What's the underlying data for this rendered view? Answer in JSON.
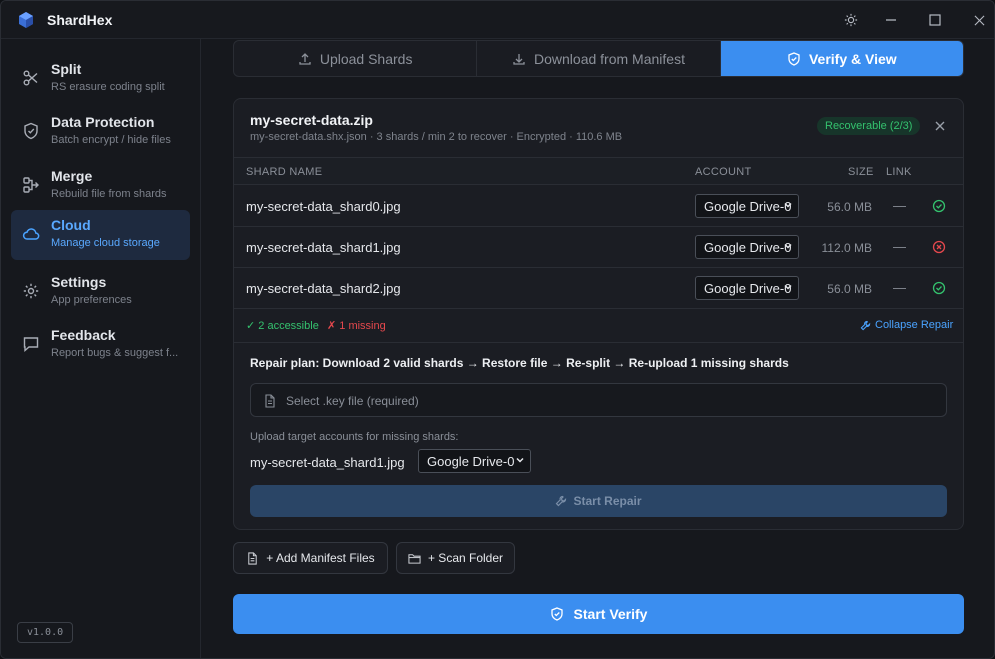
{
  "app": {
    "title": "ShardHex",
    "version": "v1.0.0"
  },
  "sidebar": {
    "items": [
      {
        "label": "Split",
        "sub": "RS erasure coding split",
        "icon": "scissors-icon"
      },
      {
        "label": "Data Protection",
        "sub": "Batch encrypt / hide files",
        "icon": "shield-icon"
      },
      {
        "label": "Merge",
        "sub": "Rebuild file from shards",
        "icon": "merge-icon"
      },
      {
        "label": "Cloud",
        "sub": "Manage cloud storage",
        "icon": "cloud-icon",
        "active": true
      },
      {
        "label": "Settings",
        "sub": "App preferences",
        "icon": "gear-icon"
      },
      {
        "label": "Feedback",
        "sub": "Report bugs & suggest f...",
        "icon": "message-icon"
      }
    ]
  },
  "tabs": {
    "upload": "Upload Shards",
    "download": "Download from Manifest",
    "verify": "Verify & View",
    "active": "verify"
  },
  "file": {
    "name": "my-secret-data.zip",
    "meta": "my-secret-data.shx.json · 3 shards / min 2 to recover · Encrypted · 110.6 MB",
    "badge": "Recoverable (2/3)"
  },
  "table": {
    "headers": {
      "name": "SHARD NAME",
      "account": "ACCOUNT",
      "size": "SIZE",
      "link": "LINK"
    },
    "rows": [
      {
        "name": "my-secret-data_shard0.jpg",
        "account": "Google Drive-0",
        "size": "56.0 MB",
        "link": "—",
        "status": "ok"
      },
      {
        "name": "my-secret-data_shard1.jpg",
        "account": "Google Drive-0",
        "size": "112.0 MB",
        "link": "—",
        "status": "missing"
      },
      {
        "name": "my-secret-data_shard2.jpg",
        "account": "Google Drive-0",
        "size": "56.0 MB",
        "link": "—",
        "status": "ok"
      }
    ]
  },
  "summary": {
    "accessible": "✓ 2 accessible",
    "missing": "✗ 1 missing",
    "collapse": "Collapse Repair"
  },
  "repair": {
    "plan": "Repair plan: Download 2 valid shards → Restore file → Re-split → Re-upload 1 missing shards",
    "key_placeholder": "Select .key file (required)",
    "upload_label": "Upload target accounts for missing shards:",
    "missing_shard": "my-secret-data_shard1.jpg",
    "target_account": "Google Drive-0",
    "start_label": "Start Repair"
  },
  "actions": {
    "add_manifest": "+ Add Manifest Files",
    "scan_folder": "+ Scan Folder",
    "start_verify": "Start Verify"
  },
  "colors": {
    "accent": "#3b8ef0",
    "ok": "#34c26e",
    "error": "#e5484d"
  }
}
